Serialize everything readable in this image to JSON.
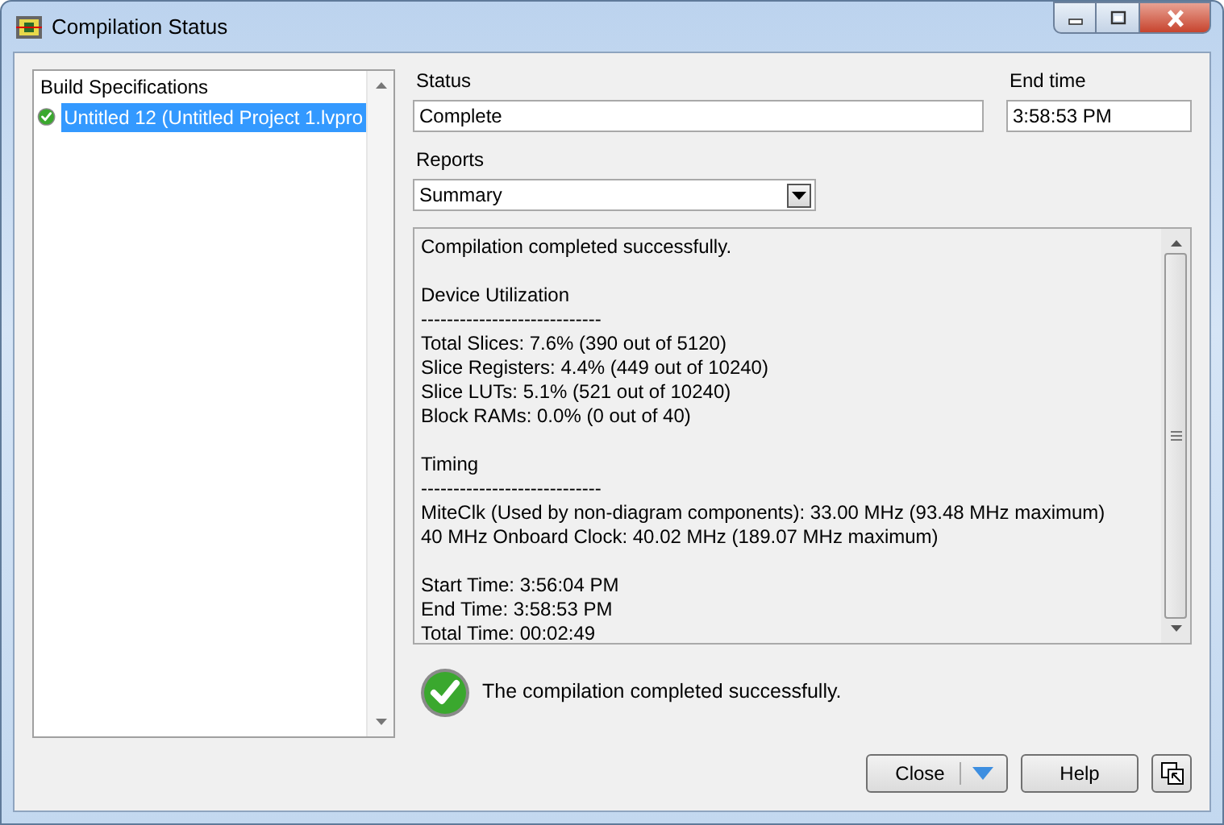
{
  "window": {
    "title": "Compilation Status"
  },
  "build_specifications": {
    "header": "Build Specifications",
    "items": [
      {
        "label": "Untitled 12 (Untitled Project 1.lvpro",
        "kind": "success",
        "selected": true
      }
    ]
  },
  "status": {
    "label": "Status",
    "value": "Complete"
  },
  "end_time": {
    "label": "End time",
    "value": "3:58:53 PM"
  },
  "reports": {
    "label": "Reports",
    "value": "Summary"
  },
  "report_text": [
    [
      "Compilation completed successfully."
    ],
    [
      "Device Utilization",
      "----------------------------",
      "Total Slices: 7.6% (390 out of 5120)",
      "Slice Registers: 4.4% (449 out of 10240)",
      "Slice LUTs: 5.1% (521 out of 10240)",
      "Block RAMs: 0.0% (0 out of 40)"
    ],
    [
      "Timing",
      "----------------------------",
      "MiteClk (Used by non-diagram components): 33.00 MHz (93.48 MHz maximum)",
      "40 MHz Onboard Clock: 40.02 MHz (189.07 MHz maximum)"
    ],
    [
      "Start Time: 3:56:04 PM",
      "End Time: 3:58:53 PM",
      "Total Time: 00:02:49"
    ]
  ],
  "message": {
    "kind": "success",
    "text": "The compilation completed successfully."
  },
  "buttons": [
    {
      "label": "Close",
      "kind": "split"
    },
    {
      "label": "Help",
      "kind": "plain"
    }
  ]
}
